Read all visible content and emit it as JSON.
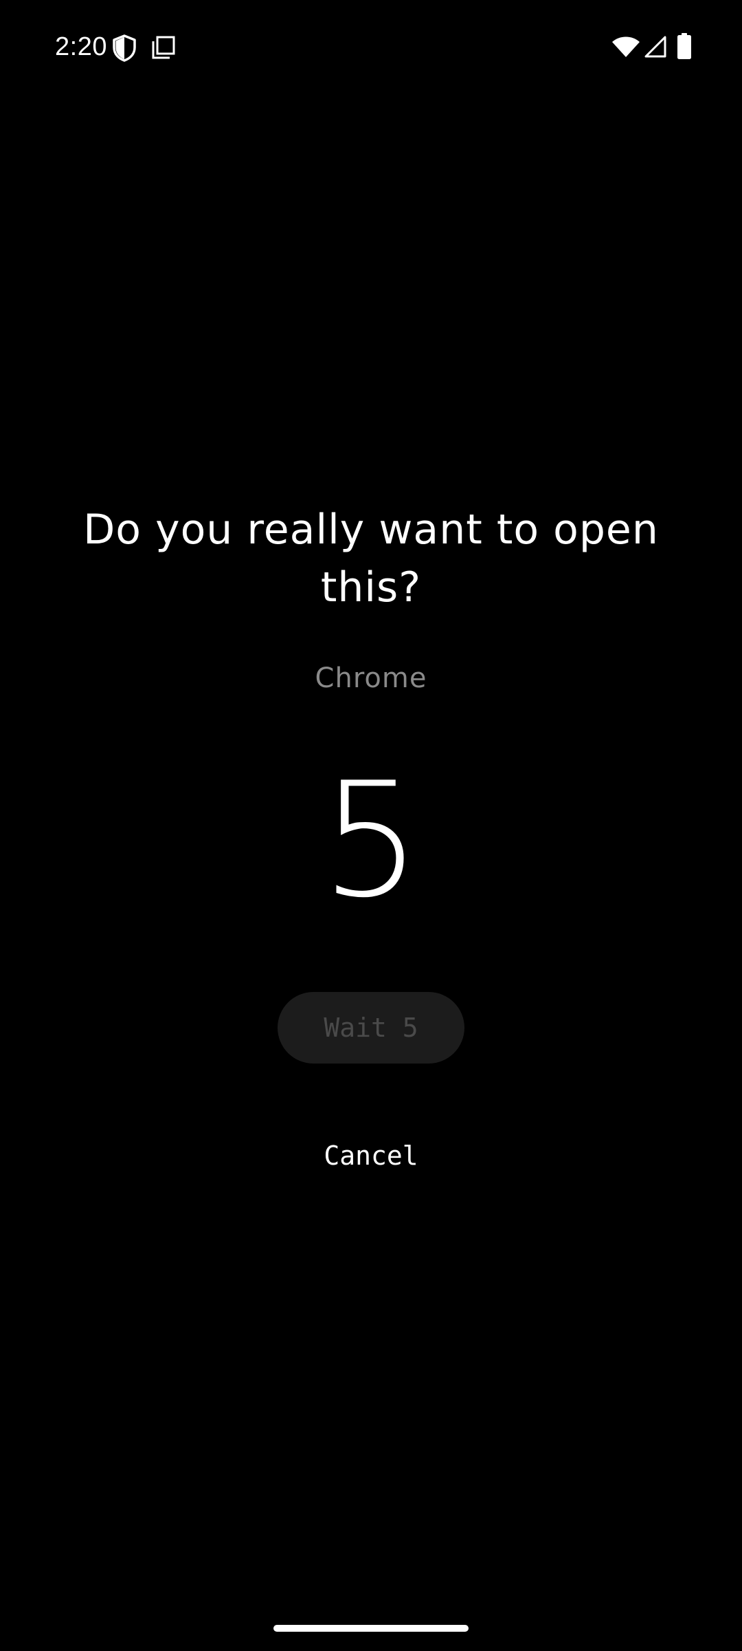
{
  "status_bar": {
    "time": "2:20",
    "icons": [
      "shield-icon",
      "cards-icon",
      "wifi-icon",
      "signal-icon",
      "battery-icon"
    ]
  },
  "dialog": {
    "question": "Do you really want to open this?",
    "app_name": "Chrome",
    "countdown": "5",
    "wait_button_label": "Wait 5",
    "cancel_button_label": "Cancel"
  },
  "colors": {
    "background": "#000000",
    "primary_text": "#ffffff",
    "secondary_text": "#8a8a8a",
    "disabled_button_bg": "#1c1c1c",
    "disabled_button_text": "#4a4a4a"
  }
}
